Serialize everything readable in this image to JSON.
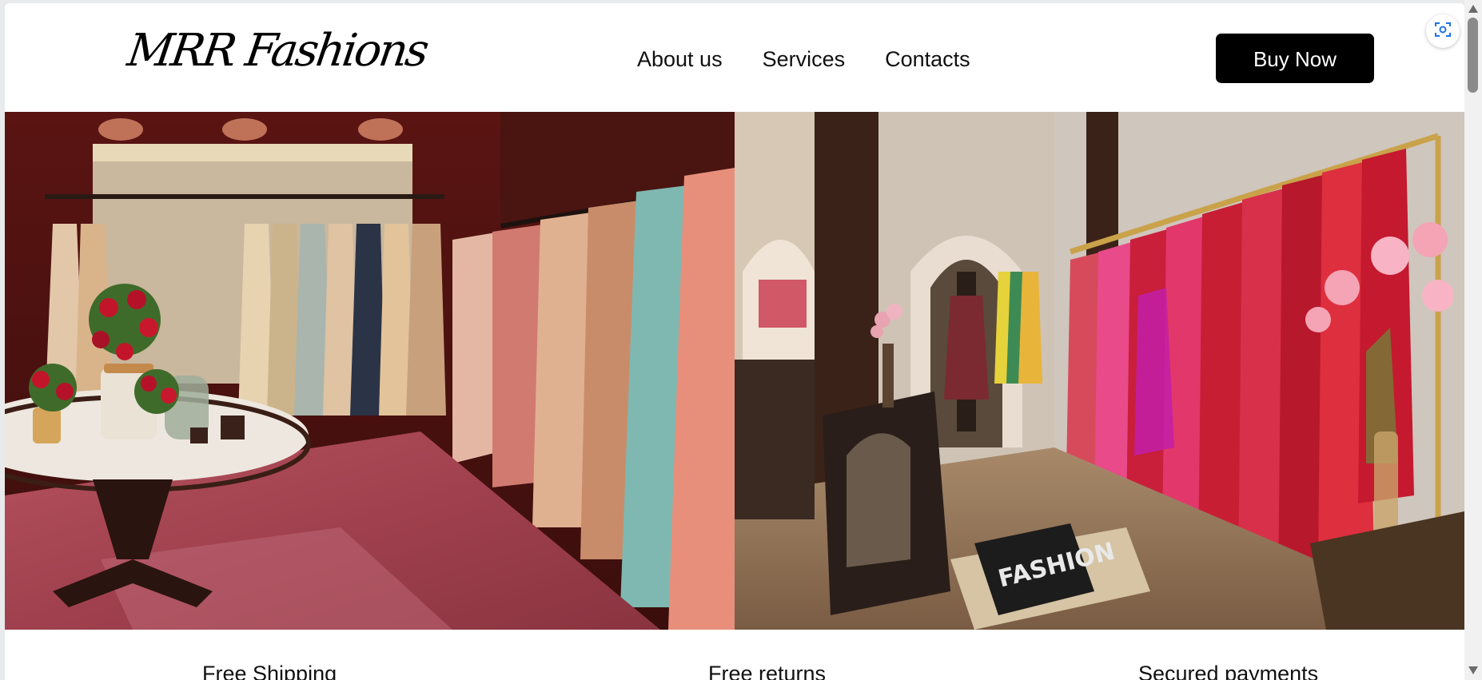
{
  "brand": {
    "name": "MRR Fashions"
  },
  "nav": {
    "links": [
      "About us",
      "Services",
      "Contacts"
    ],
    "buy_label": "Buy Now"
  },
  "hero": {
    "images": [
      {
        "alt": "Boutique showroom with embroidered lehengas on racks and marble table with flowers"
      },
      {
        "alt": "Store interior with red bridal lehengas, arched doorways, armchairs and a FASHION book"
      }
    ],
    "book_text": "FASHION"
  },
  "features": [
    "Free Shipping",
    "Free returns",
    "Secured payments"
  ],
  "icons": {
    "lens": "camera-lens-icon"
  },
  "colors": {
    "button_bg": "#000000",
    "button_text": "#ffffff",
    "page_bg": "#ffffff"
  }
}
